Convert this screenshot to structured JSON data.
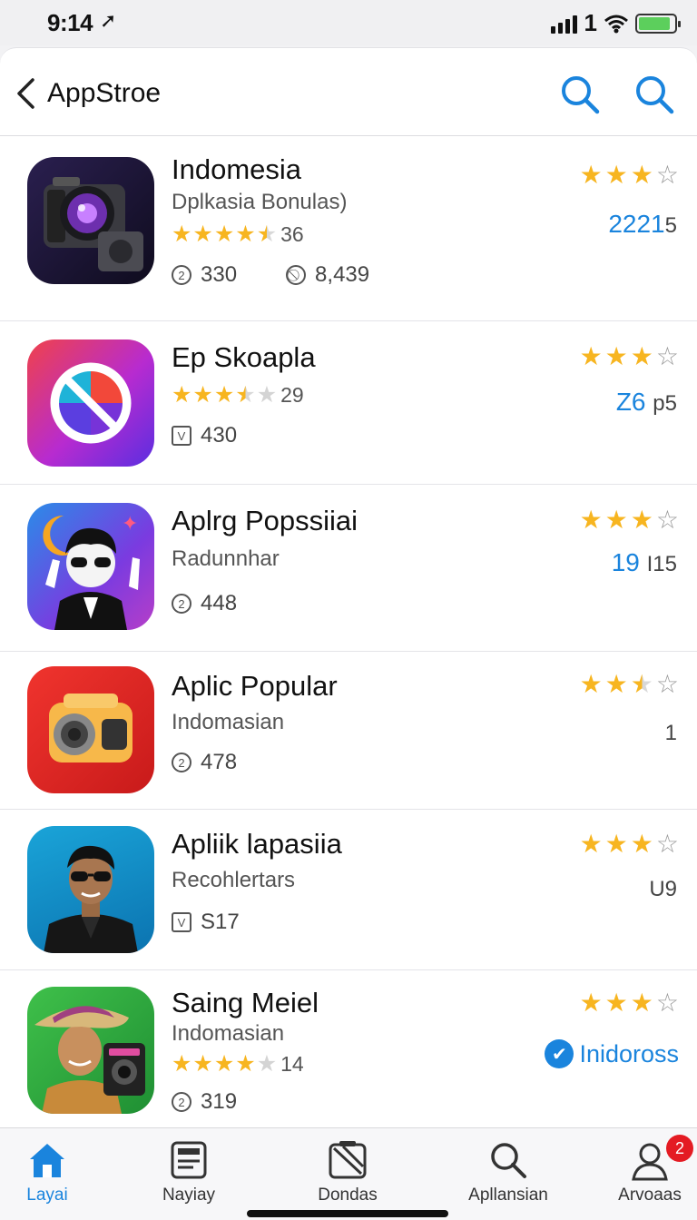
{
  "status_bar": {
    "time": "9:14",
    "right_number": "1",
    "battery_level": 0.9
  },
  "nav": {
    "title": "AppStroe"
  },
  "apps": [
    {
      "name": "Indomesia",
      "subtitle": "Dplkasia Bonulas)",
      "inline_rating": 4.5,
      "inline_count": "36",
      "stat1": "330",
      "stat2": "8,439",
      "top_rating": 3,
      "top_max": 4,
      "price_blue": "2221",
      "price_gray": "5"
    },
    {
      "name": "Ep Skoapla",
      "inline_rating": 3.5,
      "inline_count": "29",
      "stat1": "430",
      "top_rating": 3,
      "top_max": 4,
      "price_blue": "Z6",
      "price_gray": "p5"
    },
    {
      "name": "Aplrg Popssiiai",
      "subtitle": "Radunnhar",
      "stat1": "448",
      "top_rating": 3,
      "top_max": 4,
      "price_blue": "19",
      "price_gray": "I15"
    },
    {
      "name": "Aplic Popular",
      "subtitle": "Indomasian",
      "stat1": "478",
      "top_rating": 2.5,
      "top_max": 4,
      "price_gray": "1"
    },
    {
      "name": "Apliik lapasiia",
      "subtitle": "Recohlertars",
      "stat1": "S17",
      "top_rating": 3,
      "top_max": 4,
      "price_gray": "U9"
    },
    {
      "name": "Saing Meiel",
      "subtitle": "Indomasian",
      "inline_rating": 4,
      "inline_count": "14",
      "stat1": "319",
      "top_rating": 3,
      "top_max": 4,
      "link_text": "Inidoross"
    }
  ],
  "tabs": [
    {
      "label": "Layai",
      "active": true
    },
    {
      "label": "Nayiay"
    },
    {
      "label": "Dondas"
    },
    {
      "label": "Apllansian"
    },
    {
      "label": "Arvoaas",
      "badge": "2"
    }
  ],
  "colors": {
    "accent": "#1a84dd",
    "star": "#f7b520",
    "badge": "#e41b23"
  }
}
